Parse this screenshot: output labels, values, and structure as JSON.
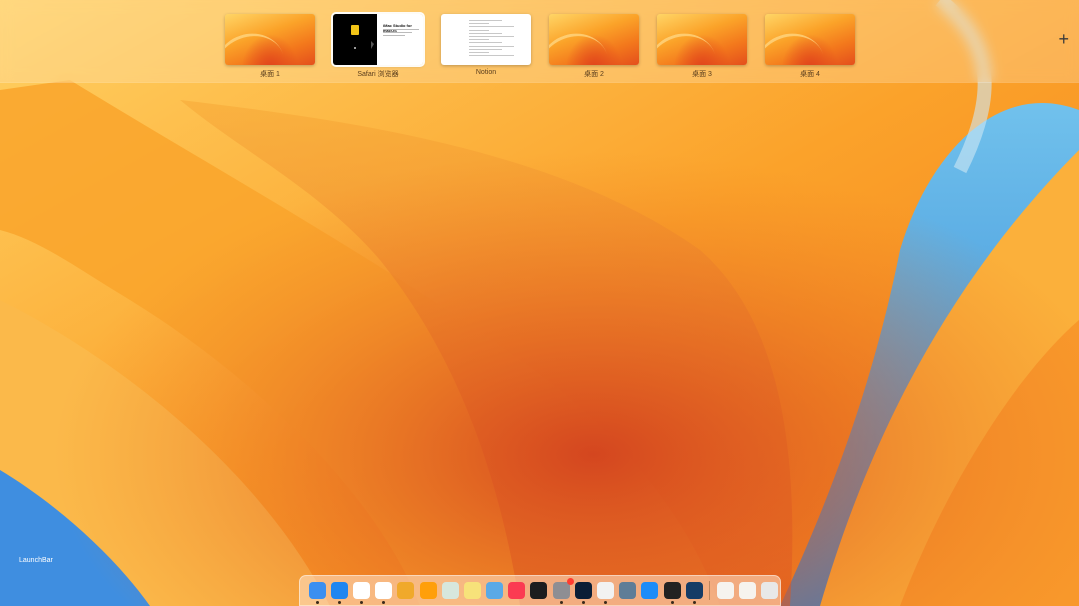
{
  "spaces": [
    {
      "label": "桌面 1",
      "kind": "wallpaper"
    },
    {
      "label": "Safari 浏览器",
      "kind": "safari",
      "active": true,
      "page_title": "iMac Studio for macOS"
    },
    {
      "label": "Notion",
      "kind": "notion"
    },
    {
      "label": "桌面 2",
      "kind": "wallpaper"
    },
    {
      "label": "桌面 3",
      "kind": "wallpaper"
    },
    {
      "label": "桌面 4",
      "kind": "wallpaper"
    }
  ],
  "add_space_glyph": "+",
  "desktop_label": "LaunchBar",
  "dock": {
    "apps": [
      {
        "icon": "finder-icon",
        "running": true,
        "bg": "#3b8ff0"
      },
      {
        "icon": "safari-icon",
        "running": true,
        "bg": "#1f86f0"
      },
      {
        "icon": "chrome-icon",
        "running": true,
        "bg": "#ffffff"
      },
      {
        "icon": "notion-icon",
        "running": true,
        "bg": "#ffffff"
      },
      {
        "icon": "tes-butterfly-icon",
        "running": false,
        "bg": "#f0a92b"
      },
      {
        "icon": "books-icon",
        "running": false,
        "bg": "#ff9f0a"
      },
      {
        "icon": "evernote-icon",
        "running": false,
        "bg": "#d7e7dc"
      },
      {
        "icon": "notes-icon",
        "running": false,
        "bg": "#f7e27a"
      },
      {
        "icon": "paper-plane-icon",
        "running": false,
        "bg": "#5aa9e6"
      },
      {
        "icon": "music-icon",
        "running": false,
        "bg": "#fb3b52"
      },
      {
        "icon": "terminal-black-icon",
        "running": false,
        "bg": "#1d1d1f"
      },
      {
        "icon": "system-preferences-icon",
        "running": true,
        "bg": "#8e8e93",
        "badge": true
      },
      {
        "icon": "photoshop-icon",
        "running": true,
        "bg": "#0b1e36"
      },
      {
        "icon": "istat-menus-icon",
        "running": true,
        "bg": "#f2f2f2"
      },
      {
        "icon": "gear-tool-icon",
        "running": false,
        "bg": "#5f7d97"
      },
      {
        "icon": "app-store-icon",
        "running": false,
        "bg": "#1d8cf8"
      },
      {
        "icon": "terminal-icon",
        "running": true,
        "bg": "#222"
      },
      {
        "icon": "copilot-icon",
        "running": true,
        "bg": "#153c66"
      }
    ],
    "stack_items": [
      {
        "icon": "document-stack-icon",
        "bg": "#f6f3ee"
      },
      {
        "icon": "downloads-stack-icon",
        "bg": "#f6f3ee"
      },
      {
        "icon": "trash-icon",
        "bg": "#e8e8e8"
      }
    ]
  }
}
